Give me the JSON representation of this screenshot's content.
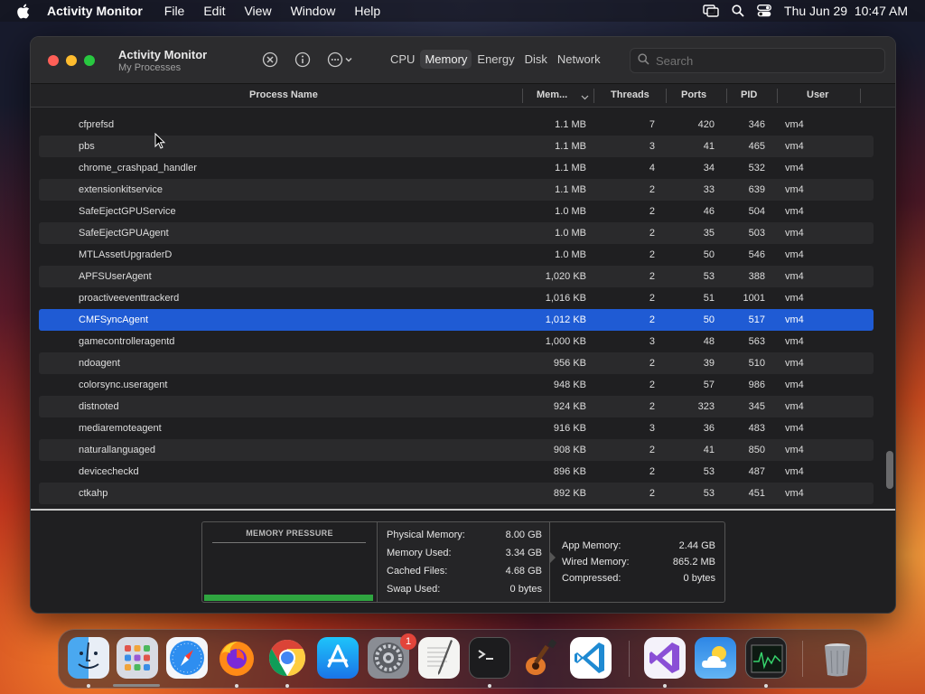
{
  "menubar": {
    "app_name": "Activity Monitor",
    "items": [
      "File",
      "Edit",
      "View",
      "Window",
      "Help"
    ],
    "clock": "Thu Jun 29  10:47 AM"
  },
  "window": {
    "title": "Activity Monitor",
    "subtitle": "My Processes",
    "tabs": [
      "CPU",
      "Memory",
      "Energy",
      "Disk",
      "Network"
    ],
    "active_tab": "Memory",
    "search_placeholder": "Search"
  },
  "columns": {
    "name": "Process Name",
    "memory": "Mem...",
    "threads": "Threads",
    "ports": "Ports",
    "pid": "PID",
    "user": "User"
  },
  "rows": [
    {
      "name": "cfprefsd",
      "memory": "1.1 MB",
      "threads": "7",
      "ports": "420",
      "pid": "346",
      "user": "vm4"
    },
    {
      "name": "pbs",
      "memory": "1.1 MB",
      "threads": "3",
      "ports": "41",
      "pid": "465",
      "user": "vm4"
    },
    {
      "name": "chrome_crashpad_handler",
      "memory": "1.1 MB",
      "threads": "4",
      "ports": "34",
      "pid": "532",
      "user": "vm4"
    },
    {
      "name": "extensionkitservice",
      "memory": "1.1 MB",
      "threads": "2",
      "ports": "33",
      "pid": "639",
      "user": "vm4"
    },
    {
      "name": "SafeEjectGPUService",
      "memory": "1.0 MB",
      "threads": "2",
      "ports": "46",
      "pid": "504",
      "user": "vm4"
    },
    {
      "name": "SafeEjectGPUAgent",
      "memory": "1.0 MB",
      "threads": "2",
      "ports": "35",
      "pid": "503",
      "user": "vm4"
    },
    {
      "name": "MTLAssetUpgraderD",
      "memory": "1.0 MB",
      "threads": "2",
      "ports": "50",
      "pid": "546",
      "user": "vm4"
    },
    {
      "name": "APFSUserAgent",
      "memory": "1,020 KB",
      "threads": "2",
      "ports": "53",
      "pid": "388",
      "user": "vm4"
    },
    {
      "name": "proactiveeventtrackerd",
      "memory": "1,016 KB",
      "threads": "2",
      "ports": "51",
      "pid": "1001",
      "user": "vm4"
    },
    {
      "name": "CMFSyncAgent",
      "memory": "1,012 KB",
      "threads": "2",
      "ports": "50",
      "pid": "517",
      "user": "vm4",
      "selected": true
    },
    {
      "name": "gamecontrolleragentd",
      "memory": "1,000 KB",
      "threads": "3",
      "ports": "48",
      "pid": "563",
      "user": "vm4"
    },
    {
      "name": "ndoagent",
      "memory": "956 KB",
      "threads": "2",
      "ports": "39",
      "pid": "510",
      "user": "vm4"
    },
    {
      "name": "colorsync.useragent",
      "memory": "948 KB",
      "threads": "2",
      "ports": "57",
      "pid": "986",
      "user": "vm4"
    },
    {
      "name": "distnoted",
      "memory": "924 KB",
      "threads": "2",
      "ports": "323",
      "pid": "345",
      "user": "vm4"
    },
    {
      "name": "mediaremoteagent",
      "memory": "916 KB",
      "threads": "3",
      "ports": "36",
      "pid": "483",
      "user": "vm4"
    },
    {
      "name": "naturallanguaged",
      "memory": "908 KB",
      "threads": "2",
      "ports": "41",
      "pid": "850",
      "user": "vm4"
    },
    {
      "name": "devicecheckd",
      "memory": "896 KB",
      "threads": "2",
      "ports": "53",
      "pid": "487",
      "user": "vm4"
    },
    {
      "name": "ctkahp",
      "memory": "892 KB",
      "threads": "2",
      "ports": "53",
      "pid": "451",
      "user": "vm4"
    }
  ],
  "stats": {
    "pressure_label": "MEMORY PRESSURE",
    "pressure_level": 1.0,
    "pressure_color": "#2fa540",
    "physical": [
      {
        "label": "Physical Memory:",
        "value": "8.00 GB"
      },
      {
        "label": "Memory Used:",
        "value": "3.34 GB"
      },
      {
        "label": "Cached Files:",
        "value": "4.68 GB"
      },
      {
        "label": "Swap Used:",
        "value": "0 bytes"
      }
    ],
    "breakdown": [
      {
        "label": "App Memory:",
        "value": "2.44 GB"
      },
      {
        "label": "Wired Memory:",
        "value": "865.2 MB"
      },
      {
        "label": "Compressed:",
        "value": "0 bytes"
      }
    ]
  },
  "dock": {
    "apps": [
      "Finder",
      "Launchpad",
      "Safari",
      "Firefox",
      "Chrome",
      "App Store",
      "System Settings",
      "TextEdit",
      "Terminal",
      "GarageBand",
      "Visual Studio Code",
      "Visual Studio",
      "Weather",
      "Activity Monitor",
      "Trash"
    ],
    "settings_badge": "1"
  },
  "colors": {
    "selection": "#1f5bd4",
    "window_bg": "#1f1f21"
  }
}
